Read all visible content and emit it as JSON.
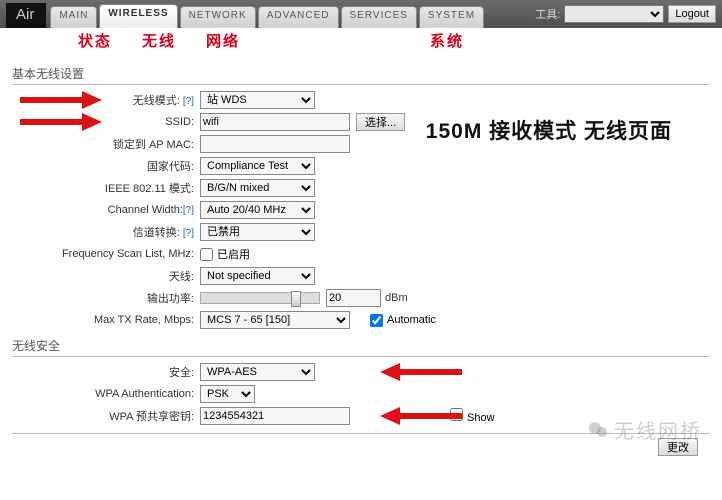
{
  "logo": "Air",
  "tabs": [
    "MAIN",
    "WIRELESS",
    "NETWORK",
    "ADVANCED",
    "SERVICES",
    "SYSTEM"
  ],
  "active_tab": 1,
  "tools_label": "工具:",
  "logout": "Logout",
  "annotations": {
    "a0": "状态",
    "a1": "无线",
    "a2": "网络",
    "a3": "系统"
  },
  "page_heading": "150M 接收模式 无线页面",
  "sections": {
    "basic": "基本无线设置",
    "security": "无线安全"
  },
  "labels": {
    "wmode": "无线模式:",
    "ssid": "SSID:",
    "lockedap": "锁定到 AP MAC:",
    "country": "国家代码:",
    "ieee": "IEEE 802.11 模式:",
    "chwidth": "Channel Width:",
    "chshift": "信道转换:",
    "freqscan": "Frequency Scan List, MHz:",
    "ant": "天线:",
    "txpower": "输出功率:",
    "maxrate": "Max TX Rate, Mbps:",
    "sec": "安全:",
    "wpaauth": "WPA Authentication:",
    "wpakey": "WPA 预共享密钥:"
  },
  "help": "[?]",
  "values": {
    "wmode": "站 WDS",
    "ssid": "wifi",
    "lockedap": "",
    "country": "Compliance Test",
    "ieee": "B/G/N mixed",
    "chwidth": "Auto 20/40 MHz",
    "chshift": "已禁用",
    "ant": "Not specified",
    "txpower": "20",
    "maxrate": "MCS 7 - 65 [150]",
    "sec": "WPA-AES",
    "wpaauth": "PSK",
    "wpakey": "1234554321"
  },
  "checkboxes": {
    "freqscan": "已启用",
    "auto": "Automatic",
    "show": "Show"
  },
  "buttons": {
    "select": "选择...",
    "change": "更改"
  },
  "units": {
    "dbm": "dBm"
  },
  "watermark": "无线网桥"
}
